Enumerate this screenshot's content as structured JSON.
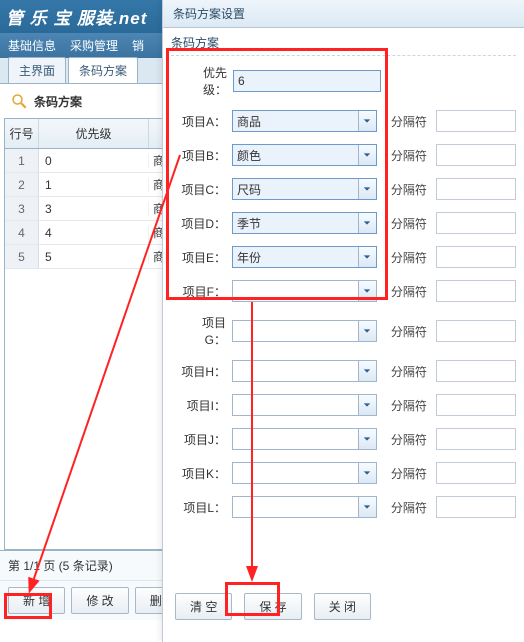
{
  "top": {
    "brand": "管 乐 宝  服装.net"
  },
  "menu": {
    "m1": "基础信息",
    "m2": "采购管理",
    "m3": "销"
  },
  "tabs": {
    "t1": "主界面",
    "t2": "条码方案"
  },
  "page": {
    "title": "条码方案"
  },
  "gridhead": {
    "h1": "行号",
    "h2": "优先级",
    "h3": ""
  },
  "rows": [
    {
      "n": "1",
      "p": "0",
      "c": "商"
    },
    {
      "n": "2",
      "p": "1",
      "c": "商"
    },
    {
      "n": "3",
      "p": "3",
      "c": "商"
    },
    {
      "n": "4",
      "p": "4",
      "c": "商"
    },
    {
      "n": "5",
      "p": "5",
      "c": "商"
    }
  ],
  "pager": {
    "text": "第 1/1 页 (5 条记录)"
  },
  "buttons": {
    "add": "新 增",
    "edit": "修 改",
    "del": "删 除"
  },
  "panel": {
    "title": "条码方案设置",
    "subtitle": "条码方案",
    "labels": {
      "prio": "优先级：",
      "a": "项目A：",
      "b": "项目B：",
      "c": "项目C：",
      "d": "项目D：",
      "e": "项目E：",
      "f": "项目F：",
      "g": "项目G：",
      "h": "项目H：",
      "i": "项目I：",
      "j": "项目J：",
      "k": "项目K：",
      "l": "项目L：",
      "sep": "分隔符"
    },
    "values": {
      "prio": "6",
      "a": "商品",
      "b": "颜色",
      "c": "尺码",
      "d": "季节",
      "e": "年份",
      "f": "",
      "g": "",
      "h": "",
      "i": "",
      "j": "",
      "k": "",
      "l": ""
    },
    "btns": {
      "clear": "清 空",
      "save": "保 存",
      "close": "关 闭"
    }
  }
}
